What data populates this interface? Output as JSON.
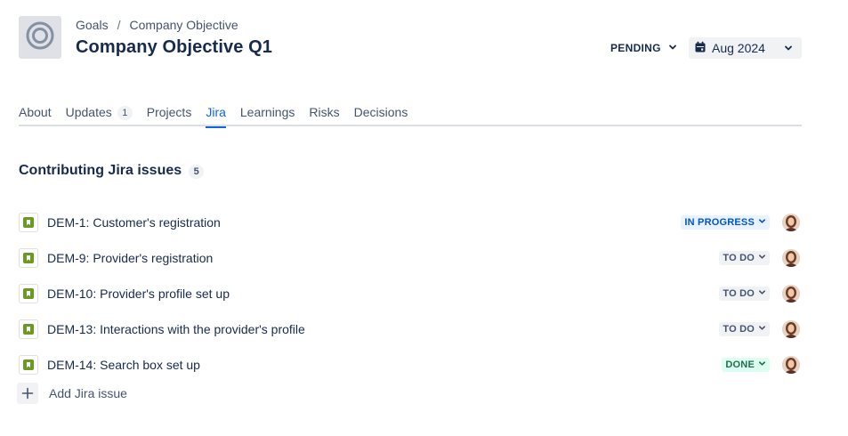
{
  "breadcrumb": {
    "root": "Goals",
    "separator": "/",
    "current": "Company Objective"
  },
  "header": {
    "title": "Company Objective Q1",
    "status": "PENDING",
    "target_date": "Aug 2024",
    "goal_icon": "target-icon"
  },
  "tabs": [
    {
      "label": "About"
    },
    {
      "label": "Updates",
      "count": "1"
    },
    {
      "label": "Projects"
    },
    {
      "label": "Jira",
      "active": true
    },
    {
      "label": "Learnings"
    },
    {
      "label": "Risks"
    },
    {
      "label": "Decisions"
    }
  ],
  "section": {
    "title": "Contributing Jira issues",
    "count": "5"
  },
  "issues": [
    {
      "title": "DEM-1: Customer's registration",
      "status": "IN PROGRESS",
      "status_kind": "inprogress"
    },
    {
      "title": "DEM-9: Provider's registration",
      "status": "TO DO",
      "status_kind": "todo"
    },
    {
      "title": "DEM-10: Provider's profile set up",
      "status": "TO DO",
      "status_kind": "todo"
    },
    {
      "title": "DEM-13: Interactions with the provider's profile",
      "status": "TO DO",
      "status_kind": "todo"
    },
    {
      "title": "DEM-14: Search box set up",
      "status": "DONE",
      "status_kind": "done"
    }
  ],
  "add_issue": {
    "label": "Add Jira issue"
  },
  "colors": {
    "accent": "#0c66e4",
    "story_icon": "#6a9a23",
    "in_progress_bg": "#e9f2ff",
    "done_bg": "#dcfff1"
  }
}
